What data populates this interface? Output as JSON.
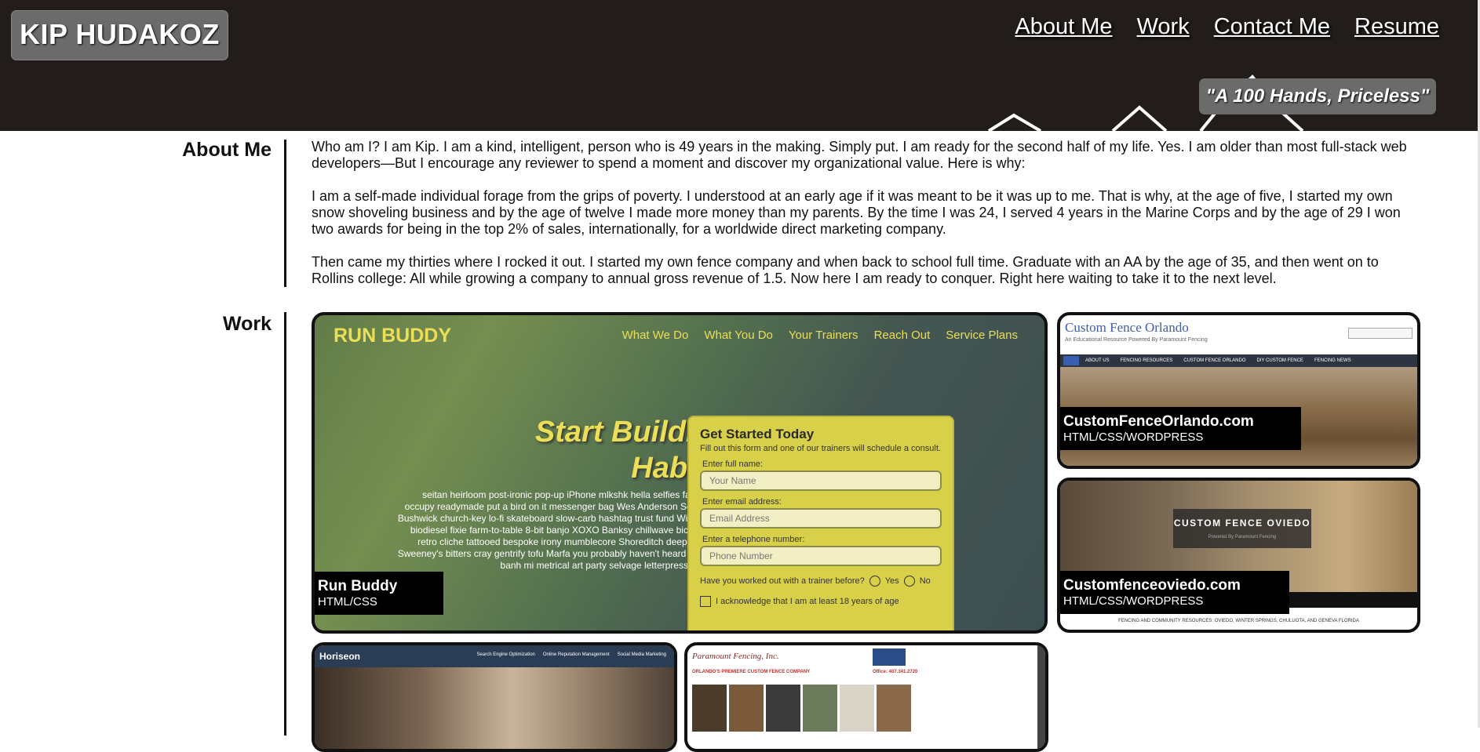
{
  "header": {
    "logo": "KIP HUDAKOZ",
    "nav": [
      "About Me",
      "Work",
      "Contact Me",
      "Resume"
    ],
    "quote": "\"A 100 Hands, Priceless\""
  },
  "about": {
    "heading": "About Me",
    "paragraphs": [
      "Who am I? I am Kip. I am a kind, intelligent, person who is 49 years in the making. Simply put. I am ready for the second half of my life. Yes. I am older than most full-stack web developers—But I encourage any reviewer to spend a moment and discover my organizational value. Here is why:",
      "I am a self-made individual forage from the grips of poverty. I understood at an early age if it was meant to be it was up to me. That is why, at the age of five, I started my own snow shoveling business and by the age of twelve I made more money than my parents. By the time I was 24, I served 4 years in the Marine Corps and by the age of 29 I won two awards for being in the top 2% of sales, internationally, for a worldwide direct marketing company.",
      "Then came my thirties where I rocked it out. I started my own fence company and when back to school full time. Graduate with an AA by the age of 35, and then went on to Rollins college: All while growing a company to annual gross revenue of 1.5. Now here I am ready to conquer. Right here waiting to take it to the next level."
    ]
  },
  "work": {
    "heading": "Work",
    "projects": [
      {
        "title": "Run Buddy",
        "tech": "HTML/CSS"
      },
      {
        "title": "CustomFenceOrlando.com",
        "tech": "HTML/CSS/WORDPRESS"
      },
      {
        "title": "Customfenceoviedo.com",
        "tech": "HTML/CSS/WORDPRESS"
      }
    ]
  },
  "runbuddy_preview": {
    "logo": "RUN BUDDY",
    "nav": [
      "What We Do",
      "What You Do",
      "Your Trainers",
      "Reach Out",
      "Service Plans"
    ],
    "hero_line1": "Start Building",
    "hero_line2": "Habits.",
    "body": "seitan heirloom post-ironic pop-up iPhone mlkshk hella selfies fashion axe occupy readymade put a bird on it messenger bag Wes Anderson Schlitz plaid Bushwick church-key lo-fi skateboard slow-carb hashtag trust fund Williamsburg biodiesel fixie farm-to-table 8-bit banjo XOXO Banksy chillwave bicycle rights retro cliche tattooed bespoke irony mumblecore Shoreditch deep v polaroid Sweeney's bitters cray gentrify tofu Marfa you probably haven't heard of them yr banh mi metrical art party selvage letterpress High Life.",
    "form_title": "Get Started Today",
    "form_sub": "Fill out this form and one of our trainers will schedule a consult.",
    "name_label": "Enter full name:",
    "name_placeholder": "Your Name",
    "email_label": "Enter email address:",
    "email_placeholder": "Email Address",
    "phone_label": "Enter a telephone number:",
    "phone_placeholder": "Phone Number",
    "question": "Have you worked out with a trainer before?",
    "yes": "Yes",
    "no": "No",
    "ack": "I acknowledge that I am at least 18 years of age"
  },
  "cfo_preview": {
    "title": "Custom Fence Orlando",
    "subtitle": "An Educational Resource Powered By Paramount Fencing",
    "menu": [
      "ABOUT US",
      "FENCING RESOURCES",
      "CUSTOM FENCE ORLANDO",
      "DIY CUSTOM FENCE",
      "FENCING NEWS"
    ]
  },
  "cfv_preview": {
    "banner_title": "CUSTOM FENCE OVIEDO",
    "banner_sub": "Powered By Paramount Fencing",
    "footer": "FENCING AND COMMUNITY RESOURCES: OVIEDO, WINTER SPRINGS, CHULUOTA, AND GENEVA FLORIDA"
  },
  "horiseon_preview": {
    "logo": "Horiseon",
    "nav": [
      "Search Engine Optimization",
      "Online Reputation Management",
      "Social Media Marketing"
    ]
  },
  "paramount_preview": {
    "logo": "Paramount Fencing, Inc.",
    "subtitle": "ORLANDO'S PREMIERE CUSTOM FENCE COMPANY",
    "office": "Office: 407.341.2720"
  },
  "colors": {
    "header_bg": "#221d1a",
    "accent_yellow": "#ecdf57",
    "link_blue": "#3b5fb0"
  }
}
